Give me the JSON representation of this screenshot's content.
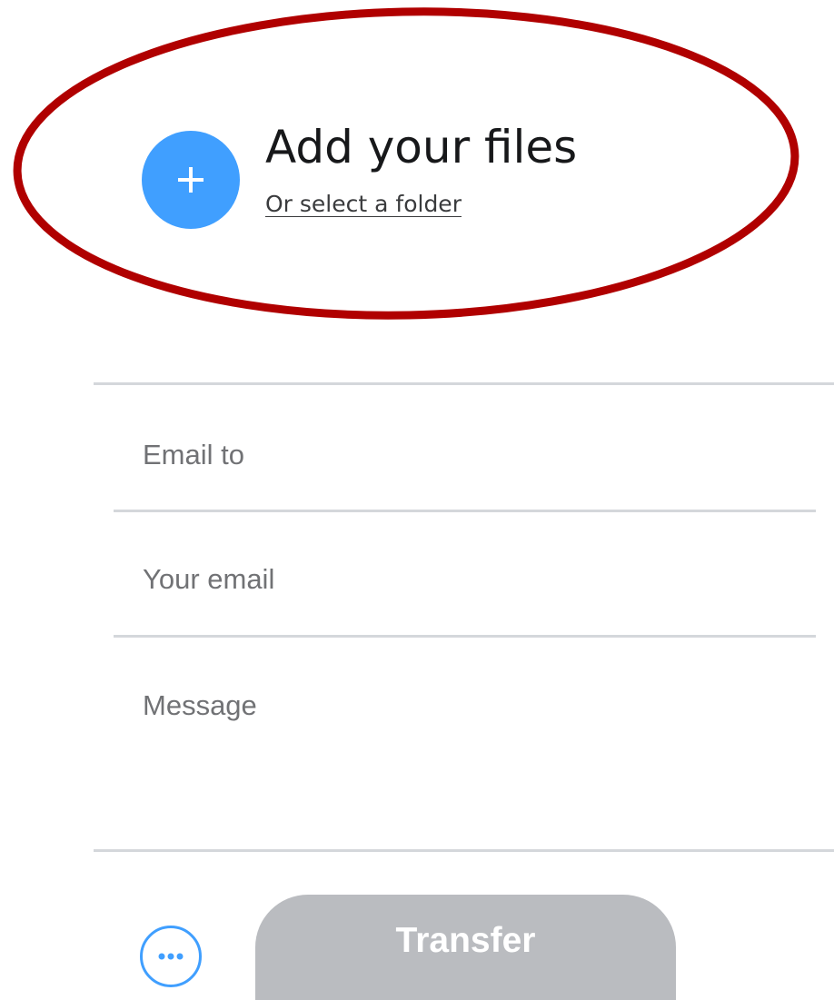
{
  "upload": {
    "title": "Add your files",
    "select_folder": "Or select a folder"
  },
  "form": {
    "email_to_placeholder": "Email to",
    "your_email_placeholder": "Your email",
    "message_placeholder": "Message"
  },
  "actions": {
    "transfer_label": "Transfer",
    "more_icon": "ellipsis-icon",
    "add_icon": "plus-icon"
  },
  "colors": {
    "accent": "#409fff",
    "annotation": "#b00000",
    "disabled_button": "#babcc0",
    "divider": "#d4d7db"
  }
}
